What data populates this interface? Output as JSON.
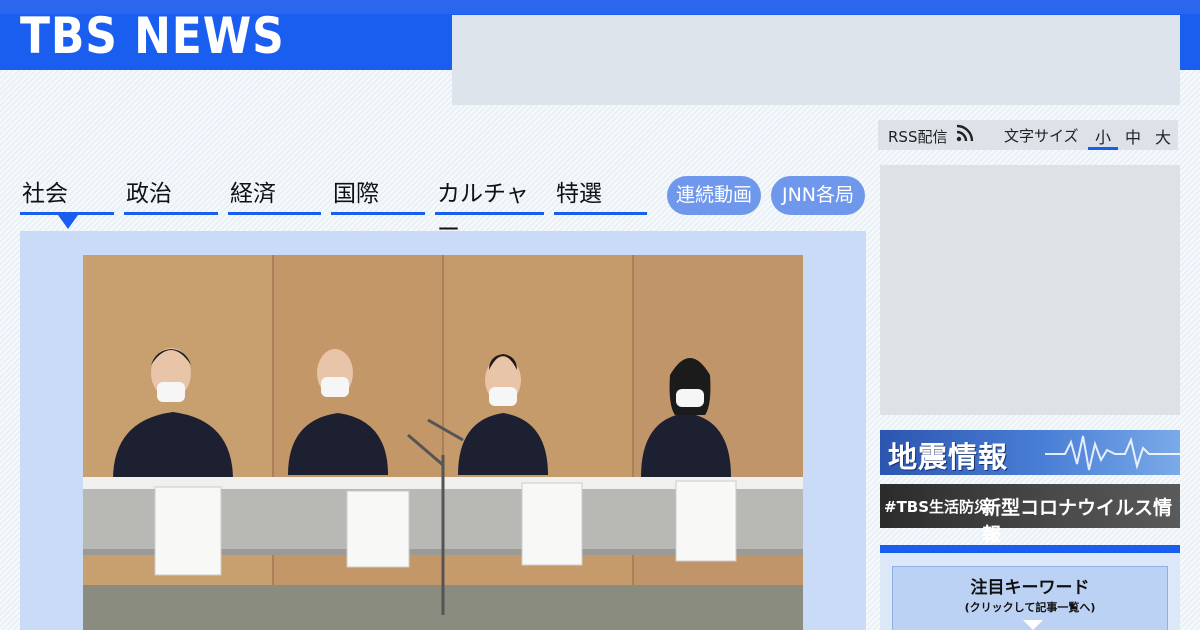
{
  "header": {
    "logo": "TBS NEWS"
  },
  "utility": {
    "rss_label": "RSS配信",
    "font_size_label": "文字サイズ",
    "font_sizes": [
      "小",
      "中",
      "大"
    ],
    "selected_font_size": "小"
  },
  "nav": {
    "categories": [
      "社会",
      "政治",
      "経済",
      "国際",
      "カルチャー",
      "特選"
    ],
    "active": "社会",
    "buttons": [
      "連続動画",
      "JNN各局"
    ]
  },
  "sidebar": {
    "quake_banner": "地震情報",
    "covid_banner_tag": "#TBS生活防災",
    "covid_banner_text": "新型コロナウイルス情報",
    "keyword_title": "注目キーワード",
    "keyword_subtitle": "(クリックして記事一覧へ)"
  },
  "colors": {
    "brand_blue": "#1a5ef0",
    "pill_blue": "#6f98ec",
    "panel_blue": "#c9dbf7"
  }
}
